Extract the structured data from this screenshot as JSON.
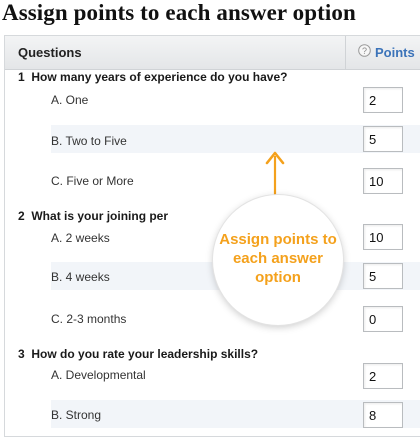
{
  "page_title": "Assign points to each answer option",
  "header": {
    "questions_label": "Questions",
    "points_label": "Points",
    "help_icon": "question-circle-icon"
  },
  "questions": [
    {
      "number": "1",
      "text": "How many years of experience do you have?",
      "options": [
        {
          "label": "A. One",
          "points": "2"
        },
        {
          "label": "B. Two to Five",
          "points": "5"
        },
        {
          "label": "C. Five or More",
          "points": "10"
        }
      ]
    },
    {
      "number": "2",
      "text": "What is your joining per",
      "options": [
        {
          "label": "A. 2 weeks",
          "points": "10"
        },
        {
          "label": "B. 4 weeks",
          "points": "5"
        },
        {
          "label": "C. 2-3 months",
          "points": "0"
        }
      ]
    },
    {
      "number": "3",
      "text": "How do you rate your leadership skills?",
      "options": [
        {
          "label": "A. Developmental",
          "points": "2"
        },
        {
          "label": "B. Strong",
          "points": "8"
        }
      ]
    }
  ],
  "callout": {
    "text": "Assign points to each answer option",
    "color": "#f4a11c",
    "icon": "arrow-up-icon"
  },
  "colors": {
    "points_header": "#3b73b9",
    "row_shade": "#f2f5f9"
  }
}
